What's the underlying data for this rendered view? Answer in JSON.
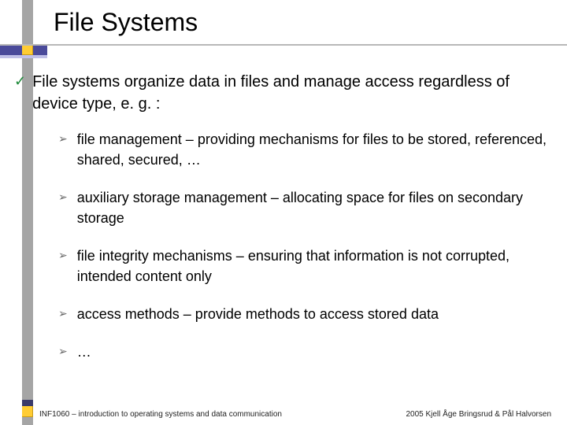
{
  "title": "File Systems",
  "intro": "File systems organize data in files and manage access regardless of device type, e. g. :",
  "bullets": {
    "b1": "file management – providing mechanisms for files to be stored, referenced, shared, secured, …",
    "b2": "auxiliary storage management – allocating space for files on secondary storage",
    "b3": "file integrity mechanisms – ensuring that information is not corrupted, intended content only",
    "b4": "access methods – provide methods to access stored data",
    "b5": "…"
  },
  "footer": {
    "left": "INF1060 – introduction to operating systems and data communication",
    "right": "2005 Kjell Åge Bringsrud & Pål Halvorsen"
  }
}
